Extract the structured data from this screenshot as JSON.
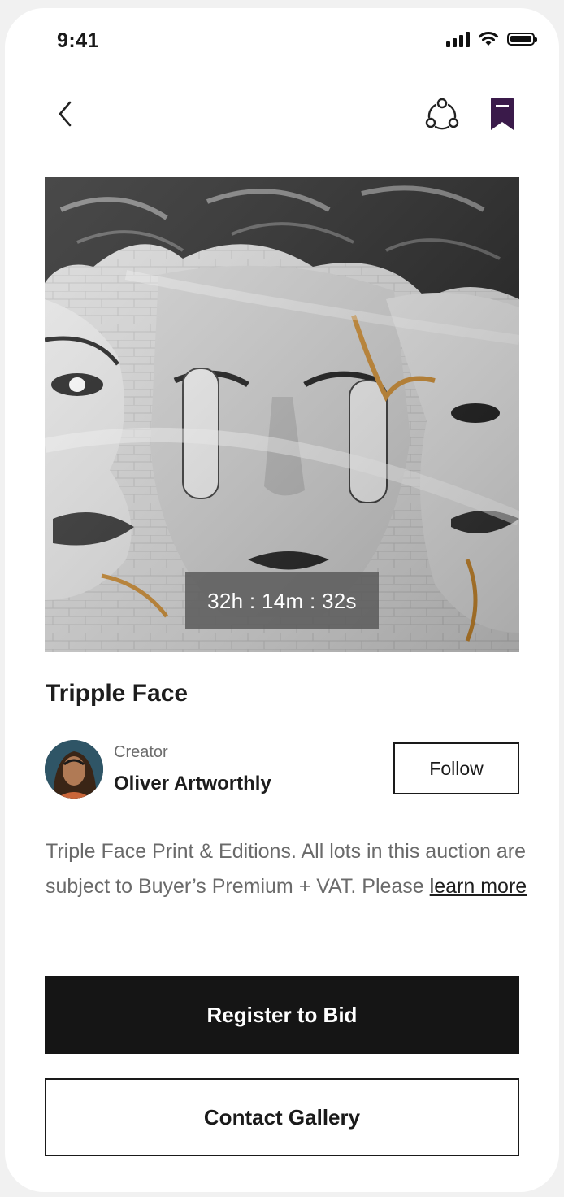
{
  "status_bar": {
    "time": "9:41"
  },
  "artwork": {
    "timer": "32h : 14m : 32s"
  },
  "product": {
    "title": "Tripple Face",
    "creator_caption": "Creator",
    "creator_name": "Oliver Artworthly",
    "follow_label": "Follow",
    "description": "Triple Face  Print & Editions. All lots in this auction are subject to Buyer’s Premium + VAT. Please",
    "learn_more": "learn more"
  },
  "actions": {
    "register_label": "Register to Bid",
    "contact_label": "Contact Gallery"
  },
  "colors": {
    "primary": "#151515",
    "bookmark": "#3a1a4a",
    "text_muted": "#6a6a6a"
  },
  "icons": [
    "back-chevron-icon",
    "share-icon",
    "bookmark-icon",
    "signal-icon",
    "wifi-icon",
    "battery-icon"
  ]
}
